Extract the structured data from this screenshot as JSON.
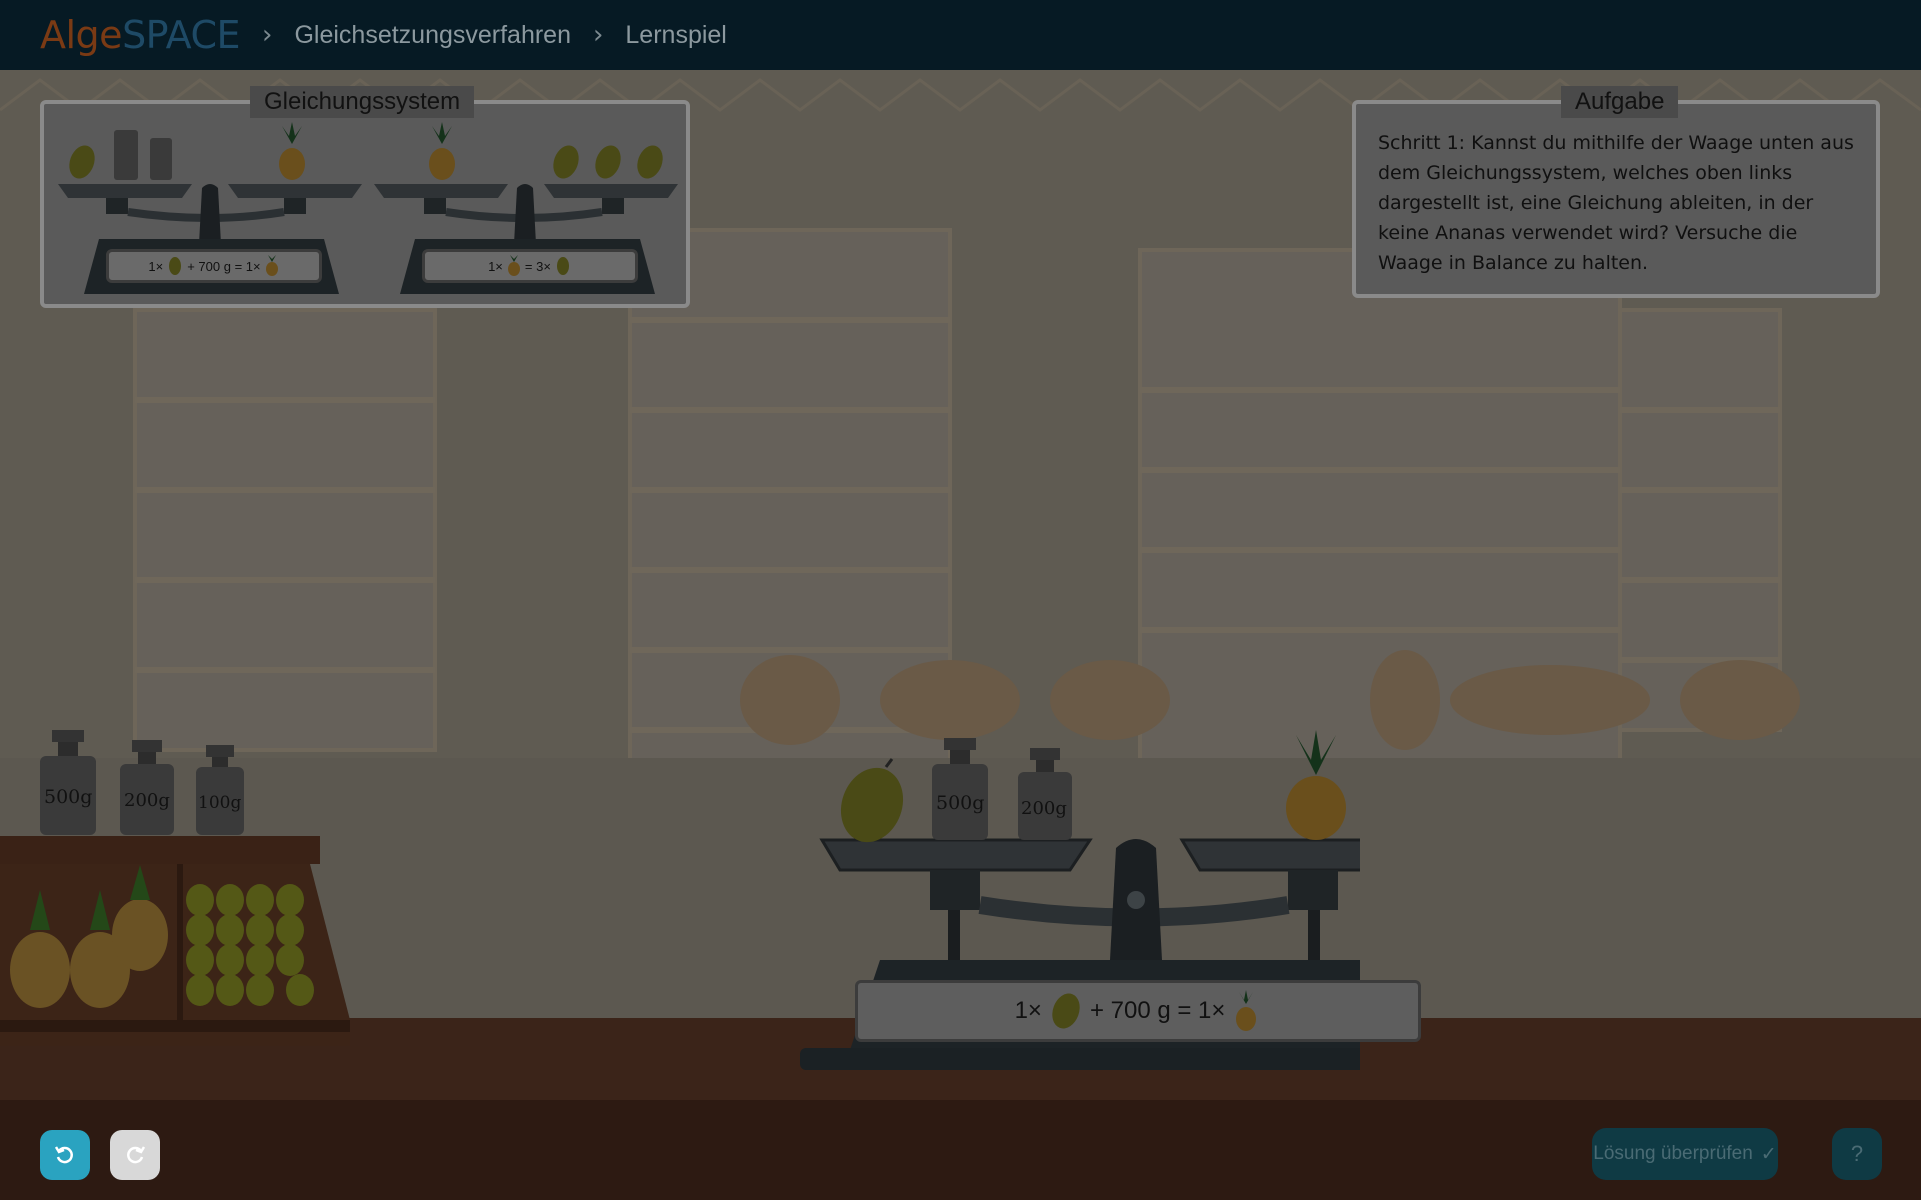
{
  "header": {
    "logo_part1": "Alge",
    "logo_part2": "SPACE",
    "breadcrumb": [
      "Gleichsetzungsverfahren",
      "Lernspiel"
    ]
  },
  "system_panel": {
    "title": "Gleichungssystem",
    "scale1": {
      "eq_prefix": "1×",
      "eq_mid": "+ 700 g = 1×"
    },
    "scale2": {
      "eq_prefix": "1×",
      "eq_mid": "= 3×"
    }
  },
  "task_panel": {
    "title": "Aufgabe",
    "text": "Schritt 1: Kannst du mithilfe der Waage unten aus dem Gleichungssystem, welches oben links dargestellt ist, eine Gleichung ableiten, in der keine Ananas verwendet wird? Versuche die Waage in Balance zu halten."
  },
  "weights_shelf": [
    "500g",
    "200g",
    "100g"
  ],
  "main_scale": {
    "left_weights": [
      "500g",
      "200g"
    ],
    "eq_prefix": "1×",
    "eq_mid": "+ 700 g = 1×"
  },
  "footer": {
    "check_label": "Lösung überprüfen",
    "help_label": "?"
  },
  "colors": {
    "undo_button": "#2aa3c0",
    "redo_button": "#d8d8d8",
    "header_bg": "#061a24"
  }
}
